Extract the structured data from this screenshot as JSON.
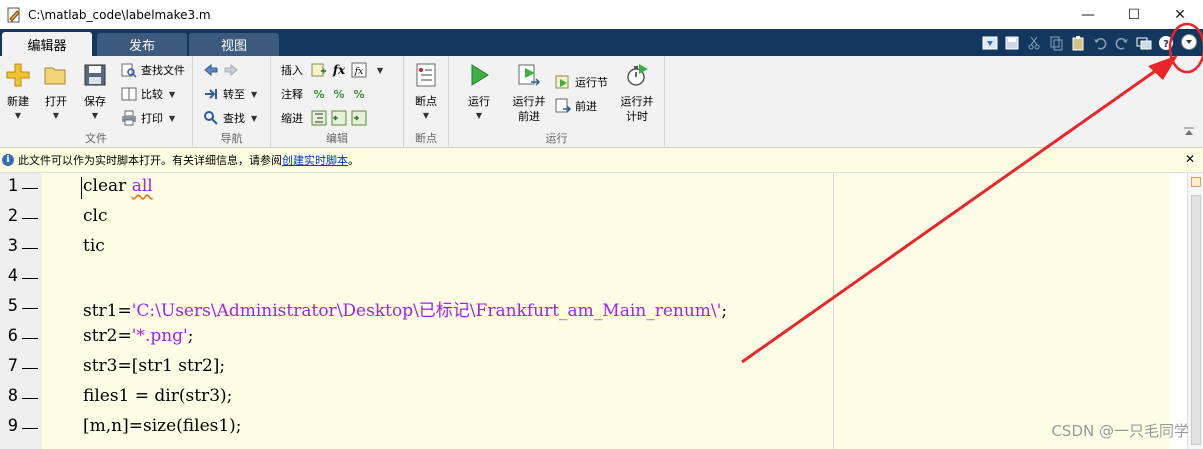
{
  "window": {
    "title": "C:\\matlab_code\\labelmake3.m",
    "controls": {
      "minimize": "—",
      "maximize": "☐",
      "close": "✕"
    }
  },
  "tabs": [
    {
      "label": "编辑器",
      "active": true
    },
    {
      "label": "发布",
      "active": false
    },
    {
      "label": "视图",
      "active": false
    }
  ],
  "ribbon": {
    "file": {
      "group_label": "文件",
      "new_label": "新建",
      "open_label": "打开",
      "save_label": "保存",
      "find_files_label": "查找文件",
      "compare_label": "比较",
      "print_label": "打印"
    },
    "navigate": {
      "group_label": "导航",
      "goto_label": "转至",
      "find_label": "查找"
    },
    "edit": {
      "group_label": "编辑",
      "insert_label": "插入",
      "comment_label": "注释",
      "indent_label": "缩进"
    },
    "breakpoints": {
      "group_label": "断点",
      "breakpoints_label": "断点"
    },
    "run": {
      "group_label": "运行",
      "run_label": "运行",
      "run_advance_label_1": "运行并",
      "run_advance_label_2": "前进",
      "run_section_label": "运行节",
      "advance_label": "前进",
      "run_time_label_1": "运行并",
      "run_time_label_2": "计时"
    }
  },
  "infobar": {
    "text": "此文件可以作为实时脚本打开。有关详细信息，请参阅 ",
    "link": "创建实时脚本",
    "suffix": "。"
  },
  "code": {
    "lines": [
      {
        "num": "1",
        "parts": [
          {
            "t": "clear ",
            "c": "plain"
          },
          {
            "t": "all",
            "c": "kw"
          }
        ]
      },
      {
        "num": "2",
        "parts": [
          {
            "t": "clc",
            "c": "plain"
          }
        ]
      },
      {
        "num": "3",
        "parts": [
          {
            "t": "tic",
            "c": "plain"
          }
        ]
      },
      {
        "num": "4",
        "parts": []
      },
      {
        "num": "5",
        "parts": [
          {
            "t": "str1=",
            "c": "plain"
          },
          {
            "t": "'C:\\Users\\Administrator\\Desktop\\已标记\\Frankfurt_am_Main_renum\\'",
            "c": "str"
          },
          {
            "t": ";",
            "c": "plain"
          }
        ]
      },
      {
        "num": "6",
        "parts": [
          {
            "t": "str2=",
            "c": "plain"
          },
          {
            "t": "'*.png'",
            "c": "str"
          },
          {
            "t": ";",
            "c": "plain"
          }
        ]
      },
      {
        "num": "7",
        "parts": [
          {
            "t": "str3=[str1 str2];",
            "c": "plain"
          }
        ]
      },
      {
        "num": "8",
        "parts": [
          {
            "t": "files1 = dir(str3);",
            "c": "plain"
          }
        ]
      },
      {
        "num": "9",
        "parts": [
          {
            "t": "[m,n]=size(files1);",
            "c": "plain"
          }
        ]
      }
    ]
  },
  "watermark": "CSDN @一只毛同学",
  "colors": {
    "tab_strip": "#14375f",
    "string": "#a020f0",
    "code_bg": "#fffde6",
    "annotation": "#e8262a"
  }
}
